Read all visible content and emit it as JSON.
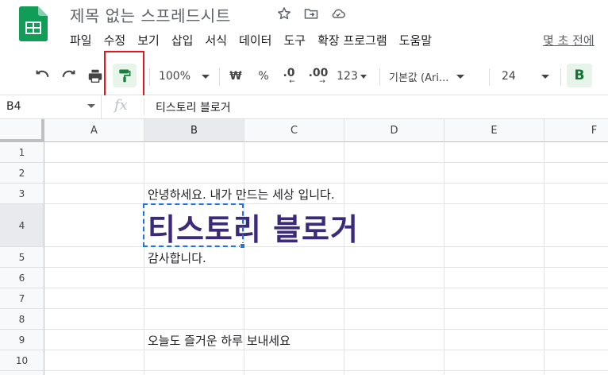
{
  "doc": {
    "title": "제목 없는 스프레드시트",
    "menu": [
      "파일",
      "수정",
      "보기",
      "삽입",
      "서식",
      "데이터",
      "도구",
      "확장 프로그램",
      "도움말"
    ],
    "last_edit": "몇 초 전에"
  },
  "toolbar": {
    "zoom": "100%",
    "currency": "₩",
    "percent": "%",
    "decrease_decimal": ".0",
    "increase_decimal": ".00",
    "number_format": "123",
    "font": "기본값 (Ari...",
    "font_size": "24",
    "bold": "B"
  },
  "formula_bar": {
    "cell_ref": "B4",
    "fx": "fx",
    "value": "티스토리 블로거"
  },
  "columns": [
    "A",
    "B",
    "C",
    "D",
    "E",
    "F"
  ],
  "rows": [
    "1",
    "2",
    "3",
    "4",
    "5",
    "6",
    "7",
    "8",
    "9",
    "10"
  ],
  "cells": {
    "B3": "안녕하세요. 내가 만드는 세상 입니다.",
    "B4": "티스토리 블로거",
    "B5": "감사합니다.",
    "B9": "오늘도 즐거운 하루 보내세요"
  },
  "colors": {
    "accent_green": "#188038",
    "highlight_red": "#e2161c",
    "selection_blue": "#1a73e8",
    "b4_text": "#3b2a7a"
  }
}
